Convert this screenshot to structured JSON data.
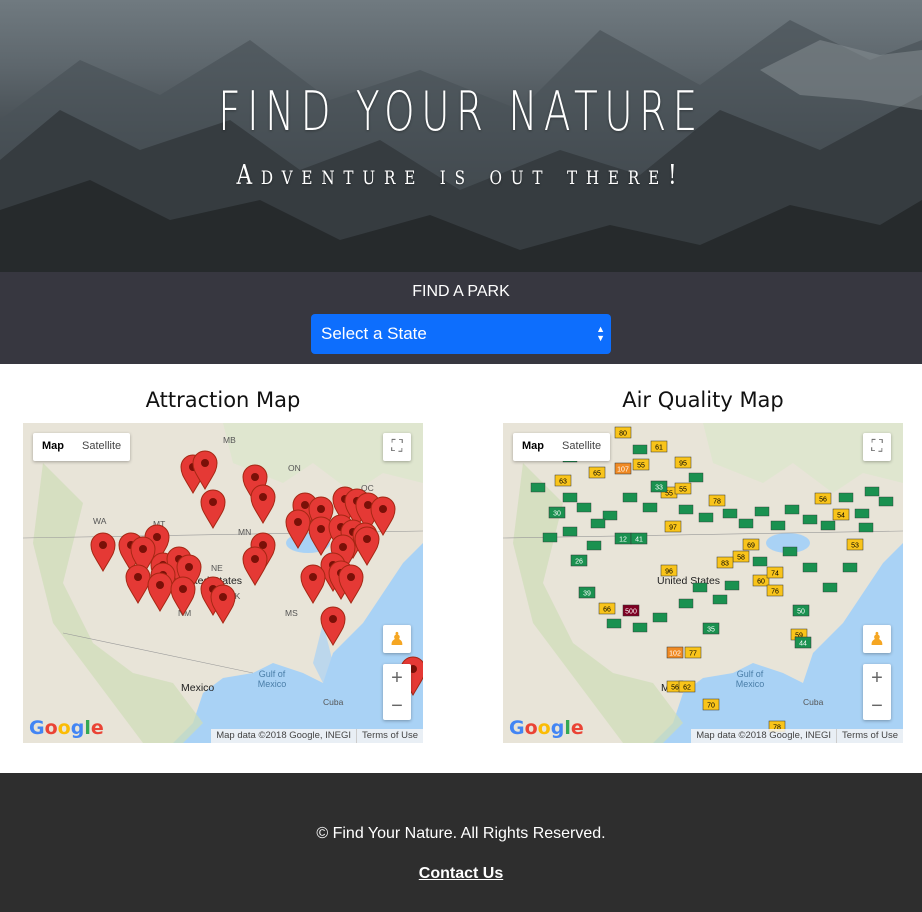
{
  "hero": {
    "title": "FIND YOUR NATURE",
    "subtitle": "Adventure is out there!"
  },
  "find_park": {
    "label": "FIND A PARK",
    "select_value": "Select a State",
    "select_color": "#0d6efd"
  },
  "attraction_map": {
    "title": "Attraction Map",
    "map_type": [
      "Map",
      "Satellite"
    ],
    "labels": {
      "mb": "MB",
      "on": "ON",
      "qc": "QC",
      "wa": "WA",
      "mt": "MT",
      "mn": "MN",
      "or": "OR",
      "ne": "NE",
      "ia": "IA",
      "united_states": "United States",
      "ok": "OK",
      "nm": "NM",
      "ms": "MS",
      "mexico": "Mexico",
      "gulf": "Gulf of Mexico",
      "cuba": "Cuba"
    },
    "attribution": "Map data ©2018 Google, INEGI",
    "terms": "Terms of Use",
    "marker_color": "#e53935"
  },
  "air_quality_map": {
    "title": "Air Quality Map",
    "map_type": [
      "Map",
      "Satellite"
    ],
    "labels": {
      "united_states": "United States",
      "mexico": "Mexico",
      "gulf": "Gulf of Mexico",
      "cuba": "Cuba"
    },
    "aqi_values": [
      "80",
      "61",
      "107",
      "55",
      "95",
      "65",
      "55",
      "55",
      "63",
      "78",
      "97",
      "12",
      "41",
      "96",
      "58",
      "83",
      "60",
      "74",
      "76",
      "56",
      "54",
      "53",
      "69",
      "66",
      "500",
      "102",
      "77",
      "56",
      "62",
      "70",
      "78",
      "50",
      "59",
      "44",
      "33",
      "30",
      "26",
      "39",
      "35"
    ],
    "attribution": "Map data ©2018 Google, INEGI",
    "terms": "Terms of Use",
    "colors": {
      "good": "#1a9150",
      "moderate": "#f9c41a",
      "unhealthy": "#f08a24",
      "hazardous": "#7e0023"
    }
  },
  "google_logo": "Google",
  "footer": {
    "copyright": "© Find Your Nature. All Rights Reserved.",
    "contact": "Contact Us"
  }
}
